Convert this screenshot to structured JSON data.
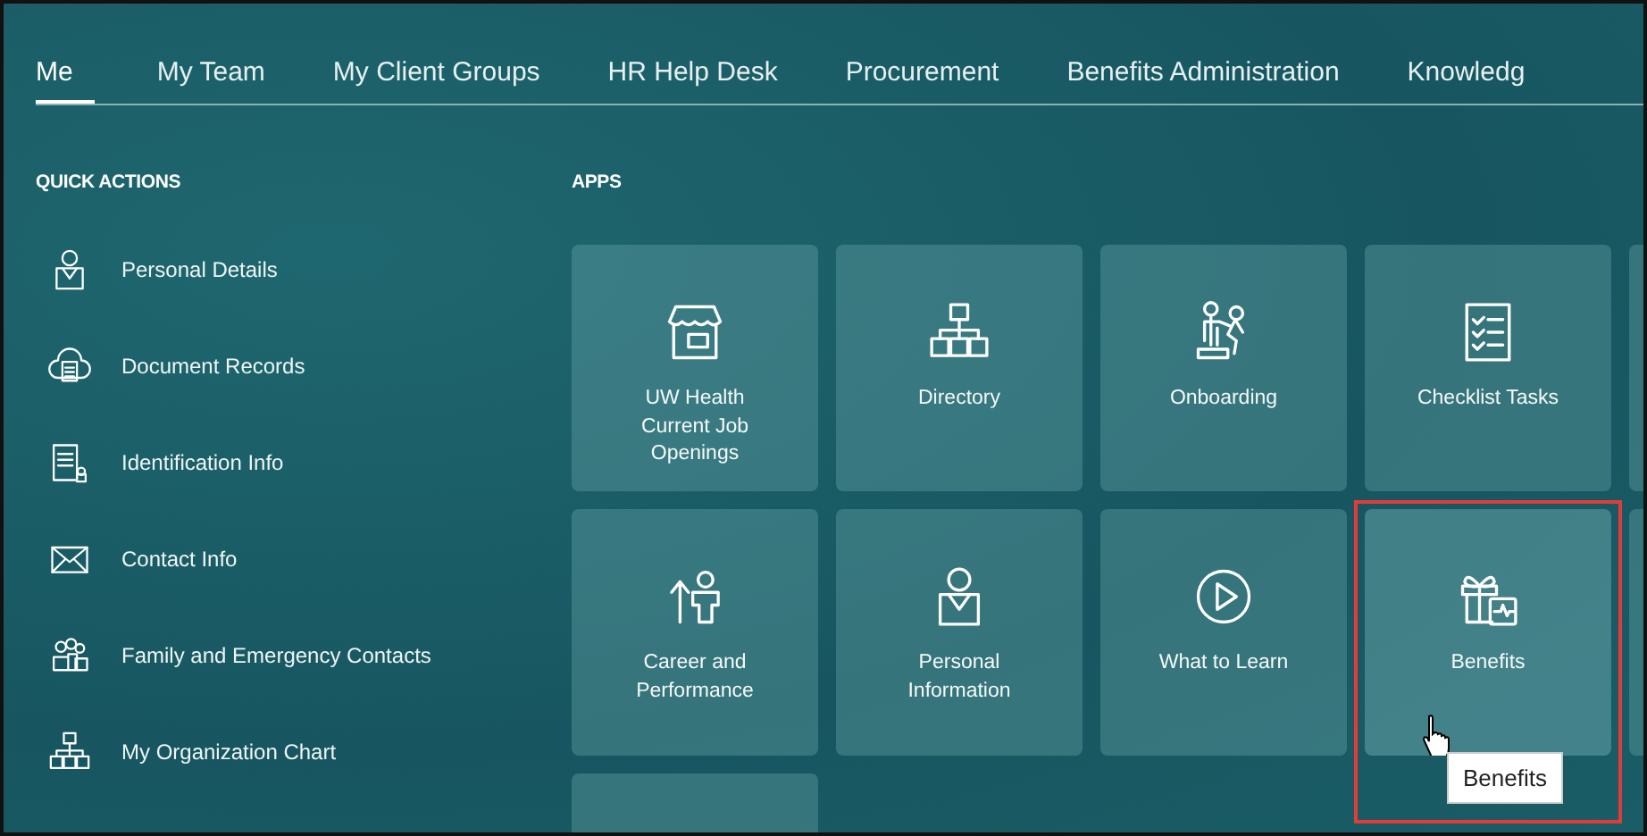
{
  "tabs": [
    {
      "label": "Me",
      "selected": true
    },
    {
      "label": "My Team",
      "selected": false
    },
    {
      "label": "My Client Groups",
      "selected": false
    },
    {
      "label": "HR Help Desk",
      "selected": false
    },
    {
      "label": "Procurement",
      "selected": false
    },
    {
      "label": "Benefits Administration",
      "selected": false
    },
    {
      "label": "Knowledg",
      "selected": false
    }
  ],
  "quick_actions": {
    "heading": "QUICK ACTIONS",
    "items": [
      {
        "label": "Personal Details"
      },
      {
        "label": "Document Records"
      },
      {
        "label": "Identification Info"
      },
      {
        "label": "Contact Info"
      },
      {
        "label": "Family and Emergency Contacts"
      },
      {
        "label": "My Organization Chart"
      }
    ]
  },
  "apps": {
    "heading": "APPS",
    "tiles": [
      {
        "kind": "app",
        "label": "UW Health Current Job Openings",
        "highlighted": false
      },
      {
        "kind": "app",
        "label": "Directory",
        "highlighted": false
      },
      {
        "kind": "app",
        "label": "Onboarding",
        "highlighted": false
      },
      {
        "kind": "app",
        "label": "Checklist Tasks",
        "highlighted": false
      },
      {
        "kind": "cut"
      },
      {
        "kind": "app",
        "label": "Career and Performance",
        "highlighted": false
      },
      {
        "kind": "app",
        "label": "Personal Information",
        "highlighted": false
      },
      {
        "kind": "app",
        "label": "What to Learn",
        "highlighted": false
      },
      {
        "kind": "app",
        "label": "Benefits",
        "highlighted": true,
        "tooltip": "Benefits"
      },
      {
        "kind": "cut"
      },
      {
        "kind": "cut"
      }
    ]
  }
}
